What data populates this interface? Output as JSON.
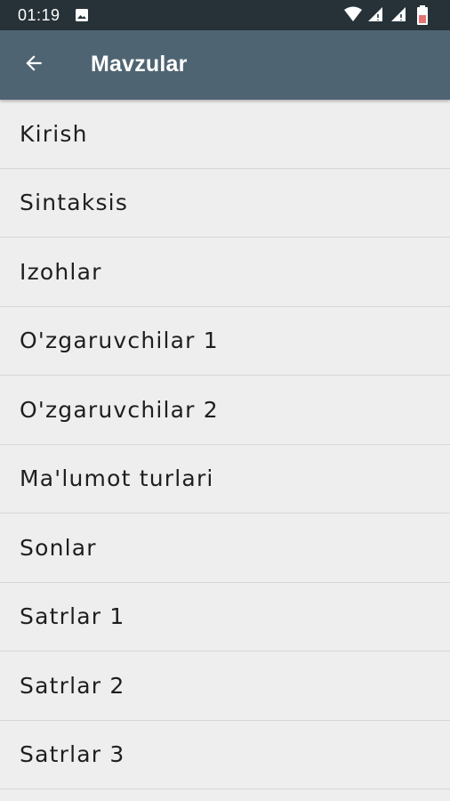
{
  "status_bar": {
    "time": "01:19",
    "icons": [
      "image-icon",
      "wifi-icon",
      "signal-icon",
      "signal-icon",
      "battery-icon"
    ]
  },
  "app_bar": {
    "title": "Mavzular",
    "back_icon": "arrow-back-icon",
    "color": "#4f6472"
  },
  "topics": [
    {
      "label": "Kirish"
    },
    {
      "label": "Sintaksis"
    },
    {
      "label": "Izohlar"
    },
    {
      "label": "O'zgaruvchilar 1"
    },
    {
      "label": "O'zgaruvchilar 2"
    },
    {
      "label": "Ma'lumot turlari"
    },
    {
      "label": "Sonlar"
    },
    {
      "label": "Satrlar 1"
    },
    {
      "label": "Satrlar 2"
    },
    {
      "label": "Satrlar 3"
    }
  ],
  "colors": {
    "status_bar": "#263238",
    "app_bar": "#4f6472",
    "background": "#eeeeee",
    "divider": "#d6d6d6",
    "battery_accent": "#e57373"
  }
}
